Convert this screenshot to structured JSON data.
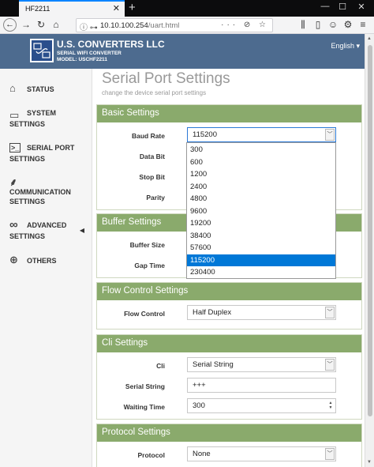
{
  "browser": {
    "tab_title": "HF2211",
    "url_host": "10.10.100.254",
    "url_path": "/uart.html",
    "url_actions": "··· ⊘ ☆"
  },
  "header": {
    "company": "U.S. CONVERTERS LLC",
    "product": "SERIAL WIFI CONVERTER",
    "model": "MODEL: USCHF2211",
    "language": "English ▾"
  },
  "sidebar": {
    "items": [
      {
        "line1": "STATUS",
        "line2": "",
        "icon": "house-icon"
      },
      {
        "line1": "SYSTEM",
        "line2": "SETTINGS",
        "icon": "monitor-icon"
      },
      {
        "line1": "SERIAL PORT",
        "line2": "SETTINGS",
        "icon": "terminal-icon"
      },
      {
        "line1": "COMMUNICATION",
        "line2": "SETTINGS",
        "icon": "network-icon"
      },
      {
        "line1": "ADVANCED",
        "line2": "SETTINGS",
        "icon": "infinity-icon"
      },
      {
        "line1": "OTHERS",
        "line2": "",
        "icon": "globe-icon"
      }
    ],
    "expand_arrow": "◀"
  },
  "page": {
    "title": "Serial Port Settings",
    "subtitle": "change the device serial port settings"
  },
  "basic": {
    "heading": "Basic Settings",
    "baud_label": "Baud Rate",
    "baud_value": "115200",
    "databit_label": "Data Bit",
    "stopbit_label": "Stop Bit",
    "parity_label": "Parity"
  },
  "baud_options": [
    "300",
    "600",
    "1200",
    "2400",
    "4800",
    "9600",
    "19200",
    "38400",
    "57600",
    "115200",
    "230400"
  ],
  "buffer": {
    "heading": "Buffer Settings",
    "size_label": "Buffer Size",
    "gap_label": "Gap Time"
  },
  "flow": {
    "heading": "Flow Control Settings",
    "label": "Flow Control",
    "value": "Half Duplex"
  },
  "cli": {
    "heading": "Cli Settings",
    "cli_label": "Cli",
    "cli_value": "Serial String",
    "string_label": "Serial String",
    "string_value": "+++",
    "wait_label": "Waiting Time",
    "wait_value": "300"
  },
  "protocol": {
    "heading": "Protocol Settings",
    "label": "Protocol",
    "value": "None"
  }
}
